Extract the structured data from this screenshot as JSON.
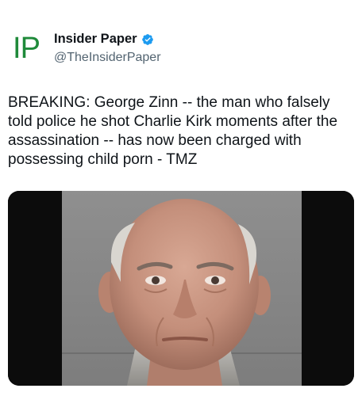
{
  "author": {
    "logo_text": "IP",
    "display_name": "Insider Paper",
    "handle": "@TheInsiderPaper",
    "verified_icon": "verified-badge-icon",
    "verified_color": "#1d9bf0"
  },
  "tweet": {
    "text": "BREAKING: George Zinn -- the man who falsely told police he shot Charlie Kirk moments after the assassination -- has now been charged with possessing child porn - TMZ"
  },
  "colors": {
    "logo": "#1f8a3a",
    "text": "#0f1419",
    "muted": "#536471"
  }
}
